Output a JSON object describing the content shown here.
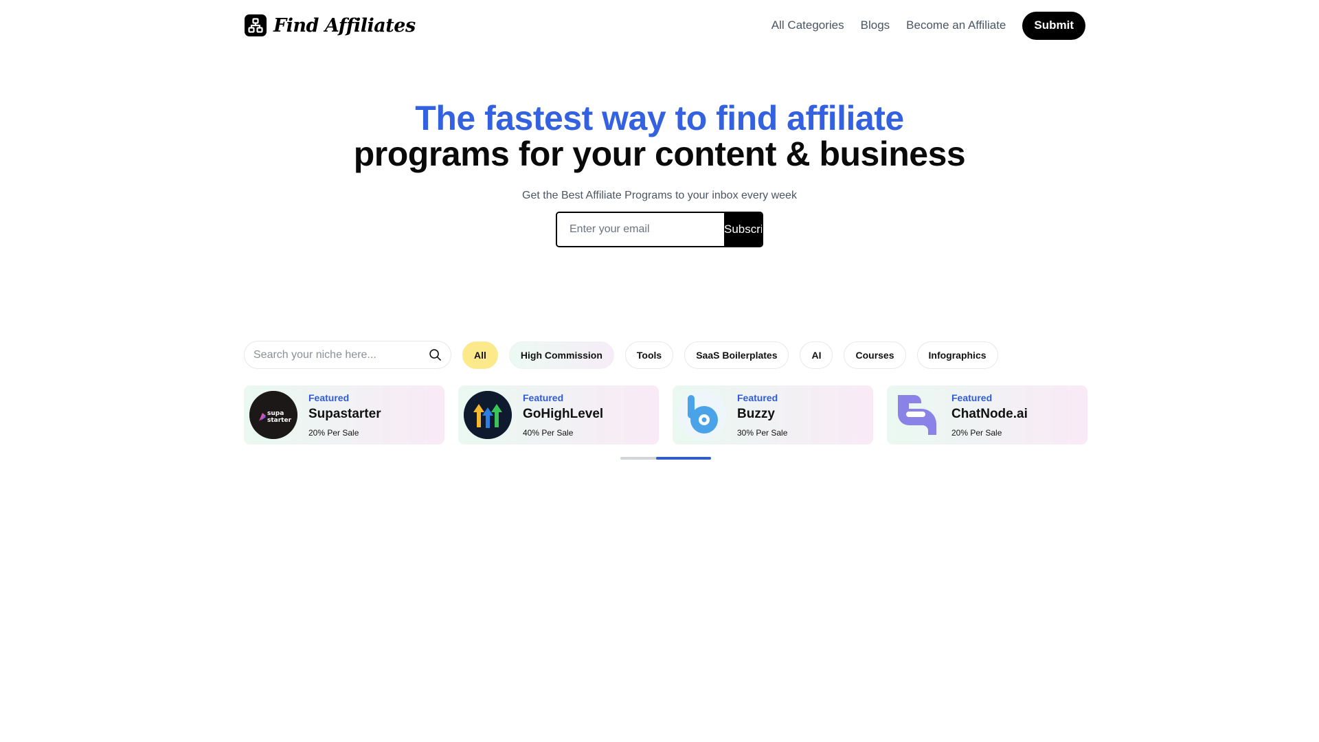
{
  "brand": {
    "name": "Find Affiliates",
    "icon": "affiliate-network-icon"
  },
  "nav": {
    "links": [
      "All Categories",
      "Blogs",
      "Become an Affiliate"
    ],
    "submit_label": "Submit"
  },
  "hero": {
    "headline_1": "The fastest way to find affiliate",
    "headline_2": "programs for your content & business",
    "subtitle": "Get the Best Affiliate Programs to your inbox every week",
    "email_placeholder": "Enter your email",
    "subscribe_label": "Subscribe"
  },
  "filters": {
    "search_placeholder": "Search your niche here...",
    "search_icon": "search-icon",
    "chips": [
      "All",
      "High Commission",
      "Tools",
      "SaaS Boilerplates",
      "AI",
      "Courses",
      "Infographics"
    ],
    "active_chip": "All"
  },
  "featured": [
    {
      "badge": "Featured",
      "name": "Supastarter",
      "commission": "20% Per Sale",
      "logo_text_1": "supa",
      "logo_text_2": "starter"
    },
    {
      "badge": "Featured",
      "name": "GoHighLevel",
      "commission": "40% Per Sale"
    },
    {
      "badge": "Featured",
      "name": "Buzzy",
      "commission": "30% Per Sale"
    },
    {
      "badge": "Featured",
      "name": "ChatNode.ai",
      "commission": "20% Per Sale"
    }
  ],
  "carousel": {
    "position": 0.4
  },
  "colors": {
    "accent_blue": "#3461e0",
    "chip_active": "#fbe98c",
    "badge_blue": "#2f5bd8"
  }
}
